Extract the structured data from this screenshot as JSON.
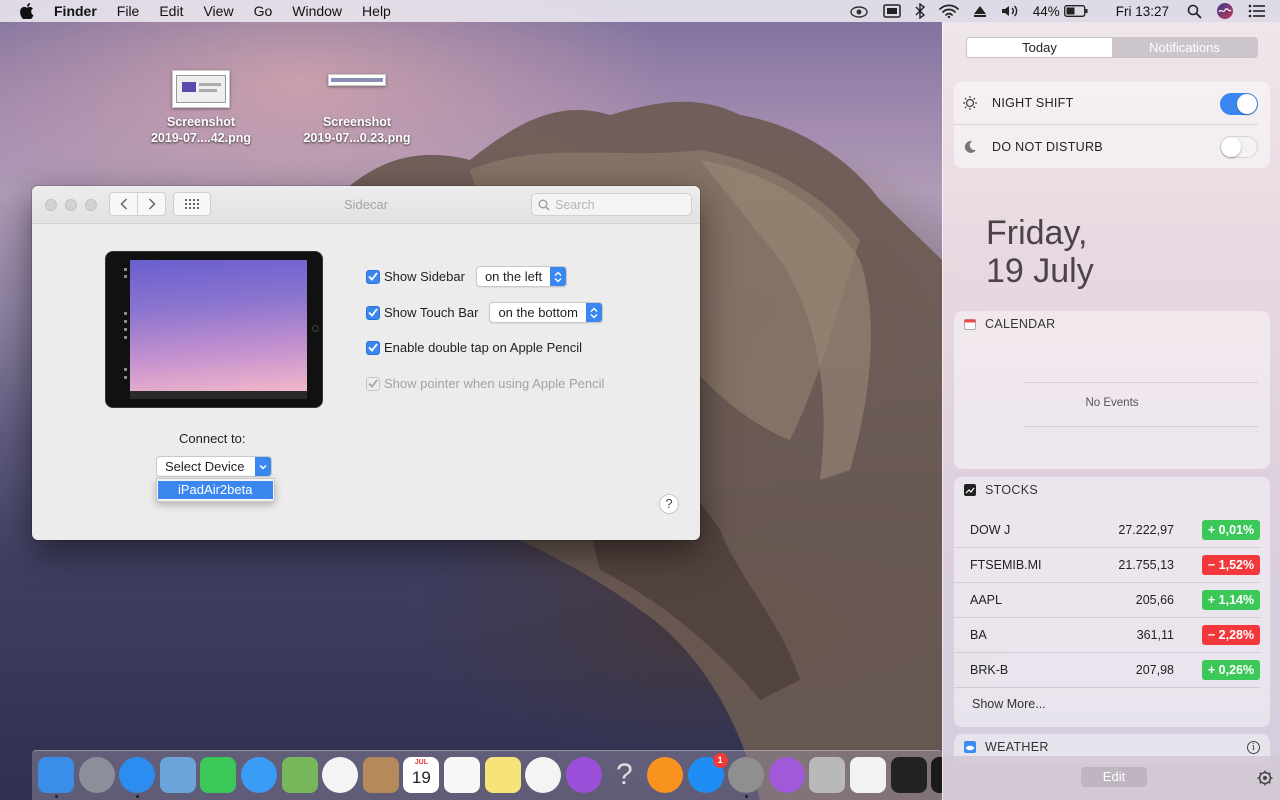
{
  "menubar": {
    "app": "Finder",
    "items": [
      "File",
      "Edit",
      "View",
      "Go",
      "Window",
      "Help"
    ],
    "battery_percent": "44%",
    "clock": "Fri 13:27"
  },
  "desktop": {
    "icons": [
      {
        "line1": "Screenshot",
        "line2": "2019-07....42.png"
      },
      {
        "line1": "Screenshot",
        "line2": "2019-07...0.23.png"
      }
    ]
  },
  "window": {
    "title": "Sidecar",
    "search_placeholder": "Search",
    "options": [
      {
        "label": "Show Sidebar",
        "checked": true,
        "popup": "on the left"
      },
      {
        "label": "Show Touch Bar",
        "checked": true,
        "popup": "on the bottom"
      },
      {
        "label": "Enable double tap on Apple Pencil",
        "checked": true
      },
      {
        "label": "Show pointer when using Apple Pencil",
        "checked": true,
        "disabled": true
      }
    ],
    "connect_label": "Connect to:",
    "select_value": "Select Device",
    "menu_item": "iPadAir2beta",
    "help": "?"
  },
  "notification_center": {
    "tabs": [
      "Today",
      "Notifications"
    ],
    "night_shift": {
      "label": "NIGHT SHIFT",
      "on": true
    },
    "dnd": {
      "label": "DO NOT DISTURB",
      "on": false
    },
    "date_line1": "Friday,",
    "date_line2": "19 July",
    "calendar": {
      "title": "CALENDAR",
      "empty": "No Events"
    },
    "stocks": {
      "title": "STOCKS",
      "rows": [
        {
          "symbol": "DOW J",
          "value": "27.222,97",
          "change": "+ 0,01%",
          "dir": "up"
        },
        {
          "symbol": "FTSEMIB.MI",
          "value": "21.755,13",
          "change": "− 1,52%",
          "dir": "down"
        },
        {
          "symbol": "AAPL",
          "value": "205,66",
          "change": "+ 1,14%",
          "dir": "up"
        },
        {
          "symbol": "BA",
          "value": "361,11",
          "change": "− 2,28%",
          "dir": "down"
        },
        {
          "symbol": "BRK-B",
          "value": "207,98",
          "change": "+ 0,26%",
          "dir": "up"
        }
      ],
      "show_more": "Show More..."
    },
    "weather": {
      "title": "WEATHER",
      "info": "i"
    },
    "edit": "Edit"
  },
  "dock": {
    "apps": [
      {
        "name": "finder-icon",
        "color": "#3b8ee8",
        "running": true
      },
      {
        "name": "launchpad-icon",
        "color": "#8a8f99",
        "running": false
      },
      {
        "name": "safari-icon",
        "color": "#2d8cf0",
        "running": true
      },
      {
        "name": "mail-icon",
        "color": "#6aa4d8",
        "running": false
      },
      {
        "name": "facetime-icon",
        "color": "#3cc759",
        "running": false
      },
      {
        "name": "messages-icon",
        "color": "#3b9cf5",
        "running": false
      },
      {
        "name": "maps-icon",
        "color": "#78b65c",
        "running": false
      },
      {
        "name": "photos-icon",
        "color": "#f4f4f4",
        "running": false
      },
      {
        "name": "contacts-icon",
        "color": "#b58a5a",
        "running": false
      },
      {
        "name": "calendar-icon",
        "color": "#ffffff",
        "running": false,
        "text": "19",
        "label": "JUL"
      },
      {
        "name": "reminders-icon",
        "color": "#f7f7f7",
        "running": false
      },
      {
        "name": "notes-icon",
        "color": "#f8e27a",
        "running": false
      },
      {
        "name": "music-icon",
        "color": "#f4f4f4",
        "running": false
      },
      {
        "name": "podcasts-icon",
        "color": "#9b4fd9",
        "running": false
      },
      {
        "name": "help-icon",
        "color": "#8a8a8a",
        "running": false,
        "text": "?"
      },
      {
        "name": "books-icon",
        "color": "#f7931e",
        "running": false
      },
      {
        "name": "app-store-icon",
        "color": "#1e8ef5",
        "running": false,
        "badge": "1"
      },
      {
        "name": "system-preferences-icon",
        "color": "#8f8f8f",
        "running": true
      },
      {
        "name": "feedback-icon",
        "color": "#a05ad9",
        "running": false
      },
      {
        "name": "preview-icon",
        "color": "#b9b9b9",
        "running": false
      },
      {
        "name": "textedit-icon",
        "color": "#f2f2f2",
        "running": false
      },
      {
        "name": "terminal-icon",
        "color": "#222222",
        "running": false
      },
      {
        "name": "activity-icon",
        "color": "#1a1a1a",
        "running": false
      }
    ]
  }
}
